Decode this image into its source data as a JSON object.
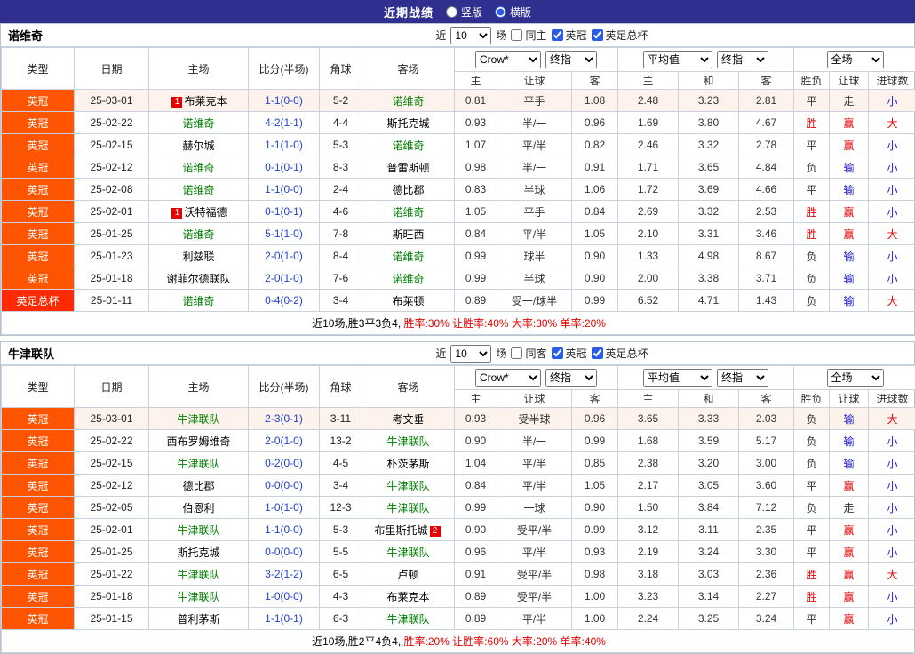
{
  "page": {
    "title": "近期战绩",
    "view_options": [
      {
        "label": "竖版",
        "selected": false
      },
      {
        "label": "横版",
        "selected": true
      }
    ]
  },
  "palette": {
    "topbar_bg": "#2f2f8f",
    "league_type_bg": "#ff5400",
    "cup_type_bg": "#ff2a00",
    "focus_team_green": "#008000",
    "score_blue": "#2244cc",
    "win_red": "#e60000",
    "lose_blue": "#2323d6",
    "recent_row_bg": "#fdf3ec"
  },
  "columns": {
    "static": [
      "类型",
      "日期",
      "主场",
      "比分(半场)",
      "角球",
      "客场"
    ],
    "subs": [
      "主",
      "让球",
      "客",
      "主",
      "和",
      "客",
      "胜负",
      "让球",
      "进球数"
    ]
  },
  "header_controls": {
    "company": "Crow*",
    "final": "终指",
    "average": "平均值",
    "scope": "全场"
  },
  "sections": [
    {
      "team": "诺维奇",
      "filter": {
        "near_label": "近",
        "count": "10",
        "unit_label": "场",
        "checkboxes": [
          {
            "label": "同主",
            "checked": false
          },
          {
            "label": "英冠",
            "checked": true
          },
          {
            "label": "英足总杯",
            "checked": true
          }
        ]
      },
      "rows": [
        {
          "type": "英冠",
          "cup": false,
          "date": "25-03-01",
          "home": {
            "name": "布莱克本",
            "focus": false,
            "badge": "1",
            "badge_pos": "left"
          },
          "score": "1-1(0-0)",
          "corner": "5-2",
          "away": {
            "name": "诺维奇",
            "focus": true
          },
          "odds": [
            "0.81",
            "平手",
            "1.08",
            "2.48",
            "3.23",
            "2.81"
          ],
          "res": [
            [
              "平",
              "dark"
            ],
            [
              "走",
              "dark"
            ],
            [
              "小",
              "blue"
            ]
          ]
        },
        {
          "type": "英冠",
          "cup": false,
          "date": "25-02-22",
          "home": {
            "name": "诺维奇",
            "focus": true
          },
          "score": "4-2(1-1)",
          "corner": "4-4",
          "away": {
            "name": "斯托克城",
            "focus": false
          },
          "odds": [
            "0.93",
            "半/一",
            "0.96",
            "1.69",
            "3.80",
            "4.67"
          ],
          "res": [
            [
              "胜",
              "red"
            ],
            [
              "赢",
              "red"
            ],
            [
              "大",
              "red"
            ]
          ]
        },
        {
          "type": "英冠",
          "cup": false,
          "date": "25-02-15",
          "home": {
            "name": "赫尔城",
            "focus": false
          },
          "score": "1-1(1-0)",
          "corner": "5-3",
          "away": {
            "name": "诺维奇",
            "focus": true
          },
          "odds": [
            "1.07",
            "平/半",
            "0.82",
            "2.46",
            "3.32",
            "2.78"
          ],
          "res": [
            [
              "平",
              "dark"
            ],
            [
              "赢",
              "red"
            ],
            [
              "小",
              "blue"
            ]
          ]
        },
        {
          "type": "英冠",
          "cup": false,
          "date": "25-02-12",
          "home": {
            "name": "诺维奇",
            "focus": true
          },
          "score": "0-1(0-1)",
          "corner": "8-3",
          "away": {
            "name": "普雷斯顿",
            "focus": false
          },
          "odds": [
            "0.98",
            "半/一",
            "0.91",
            "1.71",
            "3.65",
            "4.84"
          ],
          "res": [
            [
              "负",
              "dark"
            ],
            [
              "输",
              "blue"
            ],
            [
              "小",
              "blue"
            ]
          ]
        },
        {
          "type": "英冠",
          "cup": false,
          "date": "25-02-08",
          "home": {
            "name": "诺维奇",
            "focus": true
          },
          "score": "1-1(0-0)",
          "corner": "2-4",
          "away": {
            "name": "德比郡",
            "focus": false
          },
          "odds": [
            "0.83",
            "半球",
            "1.06",
            "1.72",
            "3.69",
            "4.66"
          ],
          "res": [
            [
              "平",
              "dark"
            ],
            [
              "输",
              "blue"
            ],
            [
              "小",
              "blue"
            ]
          ]
        },
        {
          "type": "英冠",
          "cup": false,
          "date": "25-02-01",
          "home": {
            "name": "沃特福德",
            "focus": false,
            "badge": "1",
            "badge_pos": "left"
          },
          "score": "0-1(0-1)",
          "corner": "4-6",
          "away": {
            "name": "诺维奇",
            "focus": true
          },
          "odds": [
            "1.05",
            "平手",
            "0.84",
            "2.69",
            "3.32",
            "2.53"
          ],
          "res": [
            [
              "胜",
              "red"
            ],
            [
              "赢",
              "red"
            ],
            [
              "小",
              "blue"
            ]
          ]
        },
        {
          "type": "英冠",
          "cup": false,
          "date": "25-01-25",
          "home": {
            "name": "诺维奇",
            "focus": true
          },
          "score": "5-1(1-0)",
          "corner": "7-8",
          "away": {
            "name": "斯旺西",
            "focus": false
          },
          "odds": [
            "0.84",
            "平/半",
            "1.05",
            "2.10",
            "3.31",
            "3.46"
          ],
          "res": [
            [
              "胜",
              "red"
            ],
            [
              "赢",
              "red"
            ],
            [
              "大",
              "red"
            ]
          ]
        },
        {
          "type": "英冠",
          "cup": false,
          "date": "25-01-23",
          "home": {
            "name": "利兹联",
            "focus": false
          },
          "score": "2-0(1-0)",
          "corner": "8-4",
          "away": {
            "name": "诺维奇",
            "focus": true
          },
          "odds": [
            "0.99",
            "球半",
            "0.90",
            "1.33",
            "4.98",
            "8.67"
          ],
          "res": [
            [
              "负",
              "dark"
            ],
            [
              "输",
              "blue"
            ],
            [
              "小",
              "blue"
            ]
          ]
        },
        {
          "type": "英冠",
          "cup": false,
          "date": "25-01-18",
          "home": {
            "name": "谢菲尔德联队",
            "focus": false
          },
          "score": "2-0(1-0)",
          "corner": "7-6",
          "away": {
            "name": "诺维奇",
            "focus": true
          },
          "odds": [
            "0.99",
            "半球",
            "0.90",
            "2.00",
            "3.38",
            "3.71"
          ],
          "res": [
            [
              "负",
              "dark"
            ],
            [
              "输",
              "blue"
            ],
            [
              "小",
              "blue"
            ]
          ]
        },
        {
          "type": "英足总杯",
          "cup": true,
          "date": "25-01-11",
          "home": {
            "name": "诺维奇",
            "focus": true
          },
          "score": "0-4(0-2)",
          "corner": "3-4",
          "away": {
            "name": "布莱顿",
            "focus": false
          },
          "odds": [
            "0.89",
            "受一/球半",
            "0.99",
            "6.52",
            "4.71",
            "1.43"
          ],
          "res": [
            [
              "负",
              "dark"
            ],
            [
              "输",
              "blue"
            ],
            [
              "大",
              "red"
            ]
          ]
        }
      ],
      "summary": {
        "plain": "近10场,胜3平3负4, ",
        "rates": "胜率:30% 让胜率:40% 大率:30% 单率:20%"
      }
    },
    {
      "team": "牛津联队",
      "filter": {
        "near_label": "近",
        "count": "10",
        "unit_label": "场",
        "checkboxes": [
          {
            "label": "同客",
            "checked": false
          },
          {
            "label": "英冠",
            "checked": true
          },
          {
            "label": "英足总杯",
            "checked": true
          }
        ]
      },
      "rows": [
        {
          "type": "英冠",
          "cup": false,
          "date": "25-03-01",
          "home": {
            "name": "牛津联队",
            "focus": true
          },
          "score": "2-3(0-1)",
          "corner": "3-11",
          "away": {
            "name": "考文垂",
            "focus": false
          },
          "odds": [
            "0.93",
            "受半球",
            "0.96",
            "3.65",
            "3.33",
            "2.03"
          ],
          "res": [
            [
              "负",
              "dark"
            ],
            [
              "输",
              "blue"
            ],
            [
              "大",
              "red"
            ]
          ]
        },
        {
          "type": "英冠",
          "cup": false,
          "date": "25-02-22",
          "home": {
            "name": "西布罗姆维奇",
            "focus": false
          },
          "score": "2-0(1-0)",
          "corner": "13-2",
          "away": {
            "name": "牛津联队",
            "focus": true
          },
          "odds": [
            "0.90",
            "半/一",
            "0.99",
            "1.68",
            "3.59",
            "5.17"
          ],
          "res": [
            [
              "负",
              "dark"
            ],
            [
              "输",
              "blue"
            ],
            [
              "小",
              "blue"
            ]
          ]
        },
        {
          "type": "英冠",
          "cup": false,
          "date": "25-02-15",
          "home": {
            "name": "牛津联队",
            "focus": true
          },
          "score": "0-2(0-0)",
          "corner": "4-5",
          "away": {
            "name": "朴茨茅斯",
            "focus": false
          },
          "odds": [
            "1.04",
            "平/半",
            "0.85",
            "2.38",
            "3.20",
            "3.00"
          ],
          "res": [
            [
              "负",
              "dark"
            ],
            [
              "输",
              "blue"
            ],
            [
              "小",
              "blue"
            ]
          ]
        },
        {
          "type": "英冠",
          "cup": false,
          "date": "25-02-12",
          "home": {
            "name": "德比郡",
            "focus": false
          },
          "score": "0-0(0-0)",
          "corner": "3-4",
          "away": {
            "name": "牛津联队",
            "focus": true
          },
          "odds": [
            "0.84",
            "平/半",
            "1.05",
            "2.17",
            "3.05",
            "3.60"
          ],
          "res": [
            [
              "平",
              "dark"
            ],
            [
              "赢",
              "red"
            ],
            [
              "小",
              "blue"
            ]
          ]
        },
        {
          "type": "英冠",
          "cup": false,
          "date": "25-02-05",
          "home": {
            "name": "伯恩利",
            "focus": false
          },
          "score": "1-0(1-0)",
          "corner": "12-3",
          "away": {
            "name": "牛津联队",
            "focus": true
          },
          "odds": [
            "0.99",
            "一球",
            "0.90",
            "1.50",
            "3.84",
            "7.12"
          ],
          "res": [
            [
              "负",
              "dark"
            ],
            [
              "走",
              "dark"
            ],
            [
              "小",
              "blue"
            ]
          ]
        },
        {
          "type": "英冠",
          "cup": false,
          "date": "25-02-01",
          "home": {
            "name": "牛津联队",
            "focus": true
          },
          "score": "1-1(0-0)",
          "corner": "5-3",
          "away": {
            "name": "布里斯托城",
            "focus": false,
            "badge": "2",
            "badge_pos": "right"
          },
          "odds": [
            "0.90",
            "受平/半",
            "0.99",
            "3.12",
            "3.11",
            "2.35"
          ],
          "res": [
            [
              "平",
              "dark"
            ],
            [
              "赢",
              "red"
            ],
            [
              "小",
              "blue"
            ]
          ]
        },
        {
          "type": "英冠",
          "cup": false,
          "date": "25-01-25",
          "home": {
            "name": "斯托克城",
            "focus": false
          },
          "score": "0-0(0-0)",
          "corner": "5-5",
          "away": {
            "name": "牛津联队",
            "focus": true
          },
          "odds": [
            "0.96",
            "平/半",
            "0.93",
            "2.19",
            "3.24",
            "3.30"
          ],
          "res": [
            [
              "平",
              "dark"
            ],
            [
              "赢",
              "red"
            ],
            [
              "小",
              "blue"
            ]
          ]
        },
        {
          "type": "英冠",
          "cup": false,
          "date": "25-01-22",
          "home": {
            "name": "牛津联队",
            "focus": true
          },
          "score": "3-2(1-2)",
          "corner": "6-5",
          "away": {
            "name": "卢顿",
            "focus": false
          },
          "odds": [
            "0.91",
            "受平/半",
            "0.98",
            "3.18",
            "3.03",
            "2.36"
          ],
          "res": [
            [
              "胜",
              "red"
            ],
            [
              "赢",
              "red"
            ],
            [
              "大",
              "red"
            ]
          ]
        },
        {
          "type": "英冠",
          "cup": false,
          "date": "25-01-18",
          "home": {
            "name": "牛津联队",
            "focus": true
          },
          "score": "1-0(0-0)",
          "corner": "4-3",
          "away": {
            "name": "布莱克本",
            "focus": false
          },
          "odds": [
            "0.89",
            "受平/半",
            "1.00",
            "3.23",
            "3.14",
            "2.27"
          ],
          "res": [
            [
              "胜",
              "red"
            ],
            [
              "赢",
              "red"
            ],
            [
              "小",
              "blue"
            ]
          ]
        },
        {
          "type": "英冠",
          "cup": false,
          "date": "25-01-15",
          "home": {
            "name": "普利茅斯",
            "focus": false
          },
          "score": "1-1(0-1)",
          "corner": "6-3",
          "away": {
            "name": "牛津联队",
            "focus": true
          },
          "odds": [
            "0.89",
            "平/半",
            "1.00",
            "2.24",
            "3.25",
            "3.24"
          ],
          "res": [
            [
              "平",
              "dark"
            ],
            [
              "赢",
              "red"
            ],
            [
              "小",
              "blue"
            ]
          ]
        }
      ],
      "summary": {
        "plain": "近10场,胜2平4负4, ",
        "rates": "胜率:20% 让胜率:60% 大率:20% 单率:40%"
      }
    }
  ]
}
